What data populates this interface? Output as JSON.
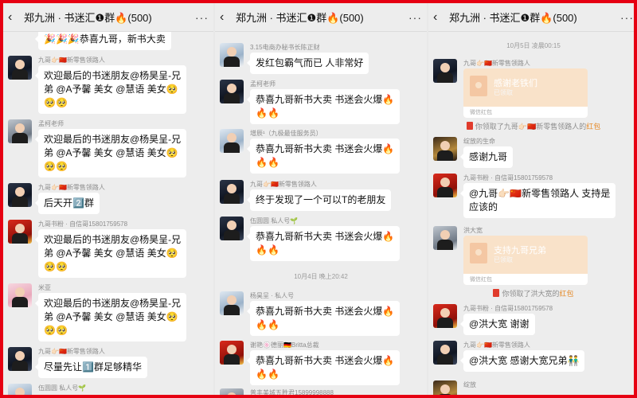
{
  "header": {
    "title": "郑九洲 · 书迷汇❶群🔥(500)",
    "back_icon": "‹",
    "more_icon": "···"
  },
  "panel1": {
    "msgs": [
      {
        "name": "",
        "lines": [
          "🎉🎉🎉恭喜九哥，新书大卖"
        ]
      },
      {
        "name": "九哥👉🏻🇨🇳新零售领路人",
        "lines": [
          "欢迎最后的书迷朋友@杨昊呈-兄",
          "弟 @A予馨  美女 @慧语  美女🥺",
          "🥺🥺"
        ]
      },
      {
        "name": "孟柯老师",
        "lines": [
          "欢迎最后的书迷朋友@杨昊呈-兄",
          "弟 @A予馨  美女 @慧语  美女🥺",
          "🥺🥺"
        ]
      },
      {
        "name": "九哥👉🏻🇨🇳新零售领路人",
        "lines": [
          "后天开2️⃣群"
        ]
      },
      {
        "name": "九哥书粉 · 自信哥15801759578",
        "lines": [
          "欢迎最后的书迷朋友@杨昊呈-兄",
          "弟 @A予馨  美女 @慧语  美女🥺",
          "🥺🥺"
        ]
      },
      {
        "name": "米亚",
        "lines": [
          "欢迎最后的书迷朋友@杨昊呈-兄",
          "弟 @A予馨  美女 @慧语  美女🥺",
          "🥺🥺"
        ]
      },
      {
        "name": "九哥👉🏻🇨🇳新零售领路人",
        "lines": [
          "尽量先让1️⃣群足够精华"
        ]
      },
      {
        "name": "伍圆圆  私人号🌱",
        "lines": []
      }
    ]
  },
  "panel2": {
    "msgs": [
      {
        "name": "3.15电商办秘书长陈正财",
        "lines": [
          "发红包霸气而已 人非常好"
        ]
      },
      {
        "name": "孟柯老师",
        "lines": [
          "恭喜九哥新书大卖 书迷会火爆🔥",
          "🔥🔥"
        ]
      },
      {
        "name": "增辰¹（九极最佳服务员）",
        "lines": [
          "恭喜九哥新书大卖 书迷会火爆🔥",
          "🔥🔥"
        ]
      },
      {
        "name": "九哥👉🏻🇨🇳新零售领路人",
        "lines": [
          "终于发现了一个可以T的老朋友"
        ]
      },
      {
        "name": "伍圆圆  私人号🌱",
        "lines": [
          "恭喜九哥新书大卖 书迷会火爆🔥",
          "🔥🔥"
        ]
      },
      {
        "name": "杨昊呈 · 私人号",
        "lines": [
          "恭喜九哥新书大卖 书迷会火爆🔥",
          "🔥🔥"
        ]
      },
      {
        "name": "谢艳🍥德丽🇩🇪Britta总裁",
        "lines": [
          "恭喜九哥新书大卖 书迷会火爆🔥",
          "🔥🔥"
        ]
      },
      {
        "name": "普丰美城五胜君15899998888",
        "lines": []
      }
    ],
    "time1": "10月4日 晚上20:42"
  },
  "panel3": {
    "time1": "10月5日 凌晨00:15",
    "msgs": [
      {
        "name": "九哥👉🏻🇨🇳新零售领路人"
      },
      {
        "name": "绽放的生命",
        "lines": [
          "感谢九哥"
        ]
      },
      {
        "name": "九哥书粉 · 自信哥15801759578",
        "lines": [
          "@九哥👉🏻🇨🇳新零售领路人  支持是",
          "应该的"
        ]
      },
      {
        "name": "洪大宽"
      },
      {
        "name": "九哥书粉 · 自信哥15801759578",
        "lines": [
          "@洪大宽  谢谢"
        ]
      },
      {
        "name": "九哥👉🏻🇨🇳新零售领路人",
        "lines": [
          "@洪大宽  感谢大宽兄弟👬"
        ]
      },
      {
        "name": "绽放",
        "lines": []
      }
    ],
    "redpacket1": {
      "title": "感谢老铁们",
      "sub": "已领取",
      "foot": "微信红包"
    },
    "redpacket2": {
      "title": "支持九哥兄弟",
      "sub": "已领取",
      "foot": "微信红包"
    },
    "sys1": {
      "pre": "你领取了九哥👉🏻🇨🇳新零售领路人的",
      "hl": "红包"
    },
    "sys2": {
      "pre": "你领取了洪大宽的",
      "hl": "红包"
    }
  },
  "colors": {
    "frame": "#e60012",
    "chat_bg": "#ededed",
    "redpacket": "#f9e2c9",
    "highlight": "#e58b2a"
  }
}
